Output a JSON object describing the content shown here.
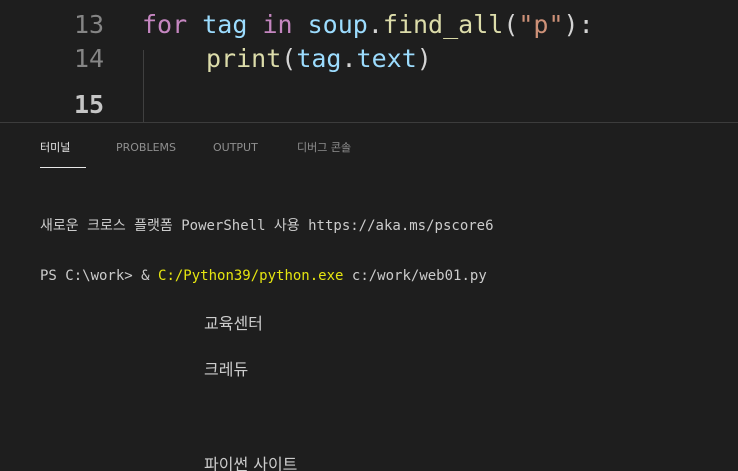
{
  "editor": {
    "lines": [
      {
        "number": "13",
        "tokens": {
          "kw1": "for",
          "var1": "tag",
          "kw2": "in",
          "var2": "soup",
          "p1": ".",
          "fn1": "find_all",
          "p2": "(",
          "str1": "\"p\"",
          "p3": "):"
        }
      },
      {
        "number": "14",
        "tokens": {
          "fn1": "print",
          "p1": "(",
          "var1": "tag",
          "p2": ".",
          "var2": "text",
          "p3": ")"
        }
      },
      {
        "number": "15"
      }
    ]
  },
  "panel": {
    "tabs": [
      {
        "label": "터미널"
      },
      {
        "label": "PROBLEMS"
      },
      {
        "label": "OUTPUT"
      },
      {
        "label": "디버그 콘솔"
      }
    ]
  },
  "terminal": {
    "banner": "새로운 크로스 플랫폼 PowerShell 사용 https://aka.ms/pscore6",
    "prompt": "PS C:\\work> &",
    "exe_path": "C:/Python39/python.exe",
    "script_arg": "c:/work/web01.py",
    "output": [
      "교육센터",
      "크레듀",
      "파이썬 사이트"
    ]
  },
  "colors": {
    "background": "#1e1e1e",
    "keyword": "#c586c0",
    "variable": "#9cdcfe",
    "function": "#dcdcaa",
    "string": "#ce9178",
    "terminal_path": "#e5e510"
  }
}
